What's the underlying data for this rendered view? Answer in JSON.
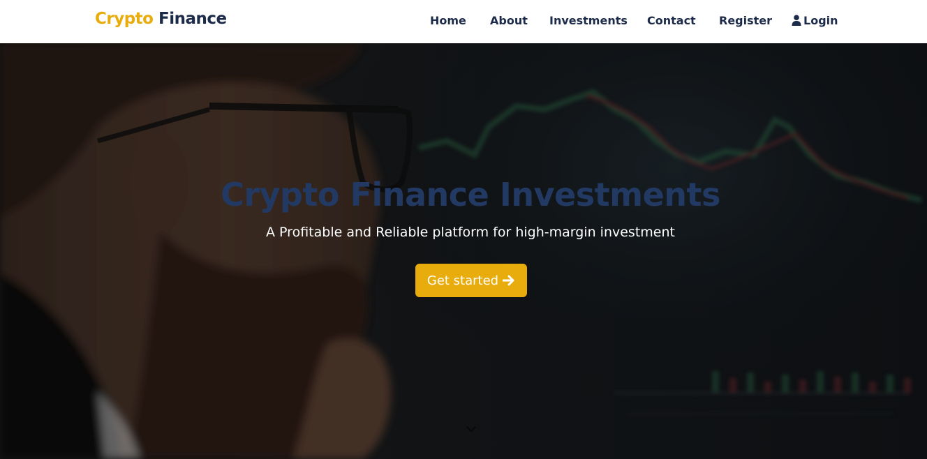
{
  "brand": {
    "accent_text": "Crypto",
    "main_text": "Finance",
    "accent_color": "#e8ac0c",
    "main_color": "#1d2b4a"
  },
  "nav": {
    "items": [
      {
        "label": "Home"
      },
      {
        "label": "About"
      },
      {
        "label": "Investments"
      },
      {
        "label": "Contact"
      },
      {
        "label": "Register"
      },
      {
        "label": "Login",
        "icon": "user-icon"
      }
    ]
  },
  "hero": {
    "title": "Crypto Finance Investments",
    "subtitle": "A Profitable and Reliable platform for high-margin investment",
    "cta_label": "Get started",
    "cta_icon": "arrow-right-icon",
    "scroll_icon": "chevron-down-icon",
    "title_color": "#223a63",
    "button_color": "#e8ac0c"
  }
}
